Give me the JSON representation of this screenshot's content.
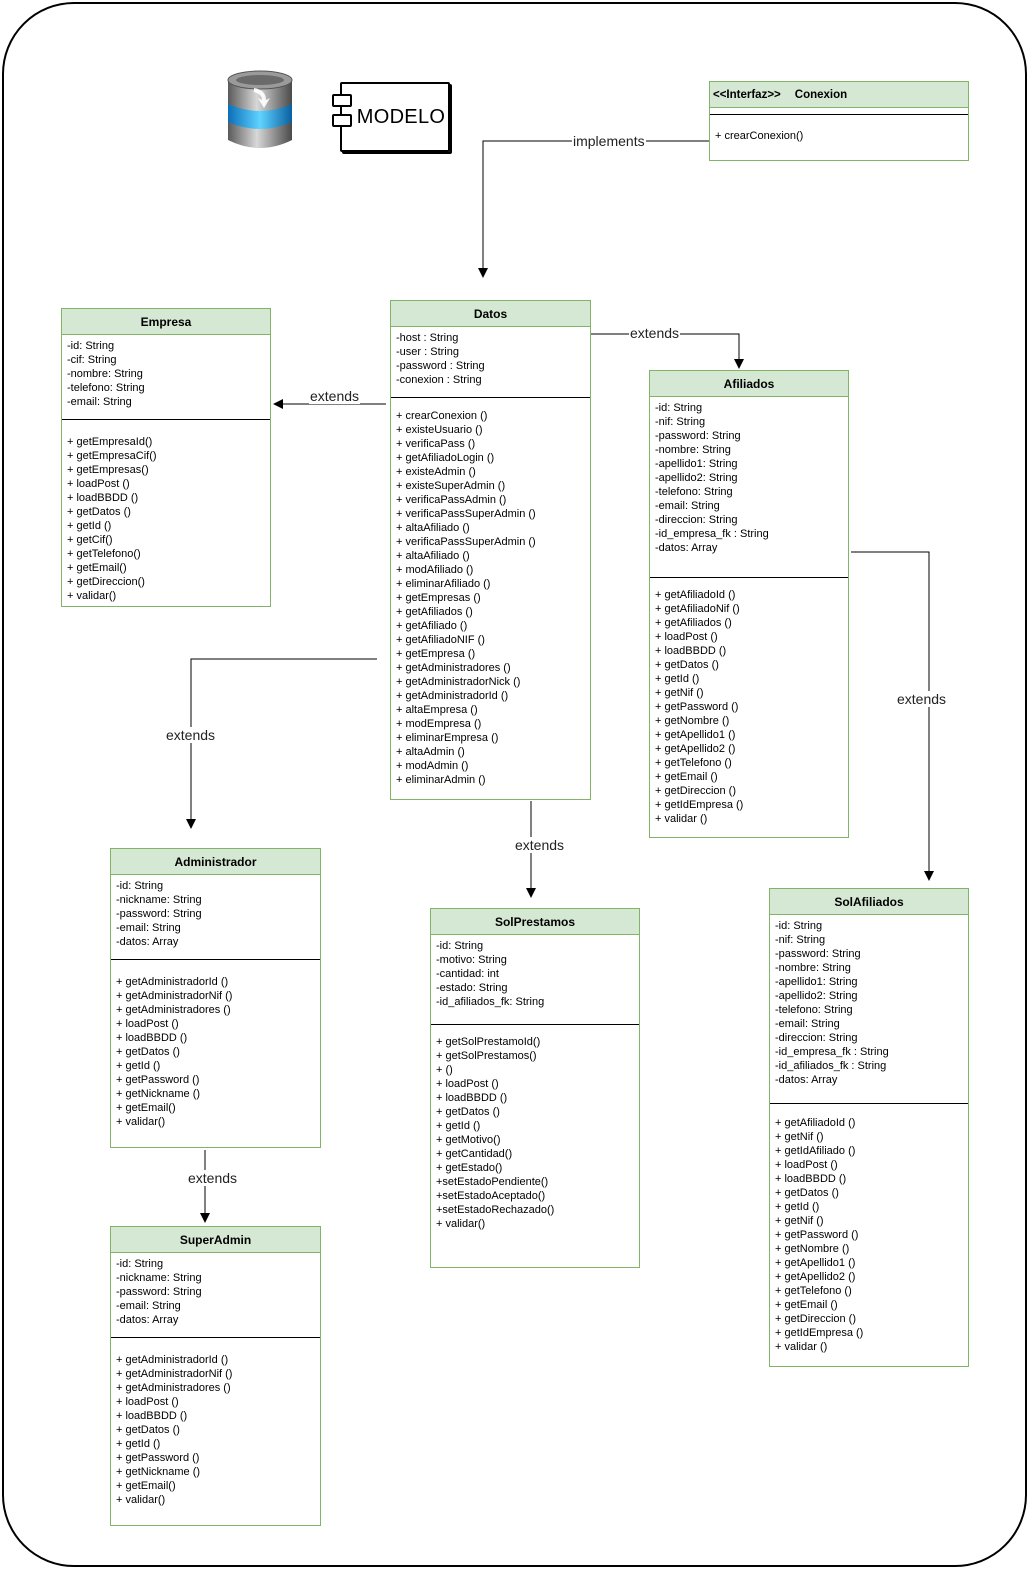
{
  "module_label": "MODELO",
  "conexion": {
    "stereotype": "<<Interfaz>>",
    "name": "Conexion",
    "methods": [
      "+ crearConexion()"
    ]
  },
  "datos": {
    "name": "Datos",
    "attributes": [
      "-host : String",
      "-user : String",
      "-password : String",
      "-conexion : String"
    ],
    "methods": [
      "+ crearConexion ()",
      "+ existeUsuario ()",
      "+ verificaPass ()",
      "+ getAfiliadoLogin ()",
      "+ existeAdmin ()",
      "+ existeSuperAdmin ()",
      "+ verificaPassAdmin ()",
      "+ verificaPassSuperAdmin ()",
      "+ altaAfiliado ()",
      "+ verificaPassSuperAdmin ()",
      "+ altaAfiliado ()",
      "+ modAfiliado ()",
      "+ eliminarAfiliado ()",
      "+ getEmpresas ()",
      "+ getAfiliados ()",
      "+ getAfiliado ()",
      "+ getAfiliadoNIF ()",
      "+ getEmpresa ()",
      "+ getAdministradores ()",
      "+ getAdministradorNick ()",
      "+ getAdministradorId ()",
      "+ altaEmpresa ()",
      "+ modEmpresa ()",
      "+ eliminarEmpresa ()",
      "+ altaAdmin ()",
      "+ modAdmin ()",
      "+ eliminarAdmin ()"
    ]
  },
  "empresa": {
    "name": "Empresa",
    "attributes": [
      "-id: String",
      "-cif: String",
      "-nombre: String",
      "-telefono: String",
      "-email: String"
    ],
    "methods": [
      "+ getEmpresaId()",
      "+ getEmpresaCif()",
      "+ getEmpresas()",
      "+ loadPost ()",
      "+ loadBBDD ()",
      "+ getDatos ()",
      "+ getId ()",
      "+ getCif()",
      "+ getTelefono()",
      "+ getEmail()",
      "+ getDireccion()",
      "+ validar()"
    ]
  },
  "afiliados": {
    "name": "Afiliados",
    "attributes": [
      "-id: String",
      "-nif: String",
      "-password: String",
      "-nombre: String",
      "-apellido1: String",
      "-apellido2: String",
      "-telefono: String",
      "-email: String",
      "-direccion: String",
      "-id_empresa_fk : String",
      "-datos: Array"
    ],
    "methods": [
      "+ getAfiliadoId ()",
      "+ getAfiliadoNif ()",
      "+ getAfiliados ()",
      "+ loadPost ()",
      "+ loadBBDD ()",
      "+ getDatos ()",
      "+ getId ()",
      "+ getNif ()",
      "+ getPassword ()",
      "+ getNombre ()",
      "+ getApellido1 ()",
      "+ getApellido2 ()",
      "+ getTelefono ()",
      "+ getEmail ()",
      "+ getDireccion ()",
      "+ getIdEmpresa ()",
      "+ validar ()"
    ]
  },
  "administrador": {
    "name": "Administrador",
    "attributes": [
      "-id: String",
      "-nickname: String",
      "-password: String",
      "-email: String",
      "-datos: Array"
    ],
    "methods": [
      "+ getAdministradorId ()",
      "+ getAdministradorNif ()",
      "+ getAdministradores ()",
      "+ loadPost ()",
      "+ loadBBDD ()",
      "+ getDatos ()",
      "+ getId ()",
      "+ getPassword ()",
      "+ getNickname ()",
      "+ getEmail()",
      "+ validar()"
    ]
  },
  "solprestamos": {
    "name": "SolPrestamos",
    "attributes": [
      "-id: String",
      "-motivo: String",
      "-cantidad: int",
      "-estado: String",
      "-id_afiliados_fk: String"
    ],
    "methods": [
      "+ getSolPrestamoId()",
      "+ getSolPrestamos()",
      "+ ()",
      "+ loadPost ()",
      "+ loadBBDD ()",
      "+ getDatos ()",
      "+ getId ()",
      "+ getMotivo()",
      "+ getCantidad()",
      "+ getEstado()",
      "+setEstadoPendiente()",
      "+setEstadoAceptado()",
      "+setEstadoRechazado()",
      "+ validar()"
    ]
  },
  "solafiliados": {
    "name": "SolAfiliados",
    "attributes": [
      "-id: String",
      "-nif: String",
      "-password: String",
      "-nombre: String",
      "-apellido1: String",
      "-apellido2: String",
      "-telefono: String",
      "-email: String",
      "-direccion: String",
      "-id_empresa_fk : String",
      "-id_afiliados_fk : String",
      "-datos: Array"
    ],
    "methods": [
      "+ getAfiliadoId ()",
      "+ getNif ()",
      "+ getIdAfiliado ()",
      "+ loadPost ()",
      "+ loadBBDD ()",
      "+ getDatos ()",
      "+ getId ()",
      "+ getNif ()",
      "+ getPassword ()",
      "+ getNombre ()",
      "+ getApellido1 ()",
      "+ getApellido2 ()",
      "+ getTelefono ()",
      "+ getEmail ()",
      "+ getDireccion ()",
      "+ getIdEmpresa ()",
      "+ validar ()"
    ]
  },
  "superadmin": {
    "name": "SuperAdmin",
    "attributes": [
      "-id: String",
      "-nickname: String",
      "-password: String",
      "-email: String",
      "-datos: Array"
    ],
    "methods": [
      "+ getAdministradorId ()",
      "+ getAdministradorNif ()",
      "+ getAdministradores ()",
      "+ loadPost ()",
      "+ loadBBDD ()",
      "+ getDatos ()",
      "+ getId ()",
      "+ getPassword ()",
      "+ getNickname ()",
      "+ getEmail()",
      "+ validar()"
    ]
  },
  "edge_labels": {
    "implements": "implements",
    "extends_afiliados": "extends",
    "extends_empresa": "extends",
    "extends_administrador": "extends",
    "extends_solprestamos": "extends",
    "extends_solafiliados": "extends",
    "extends_superadmin": "extends"
  },
  "colors": {
    "class_header_fill": "#d5e8d4",
    "class_border": "#82b366",
    "line": "#000000"
  },
  "icons": [
    "database-icon",
    "component-icon"
  ]
}
